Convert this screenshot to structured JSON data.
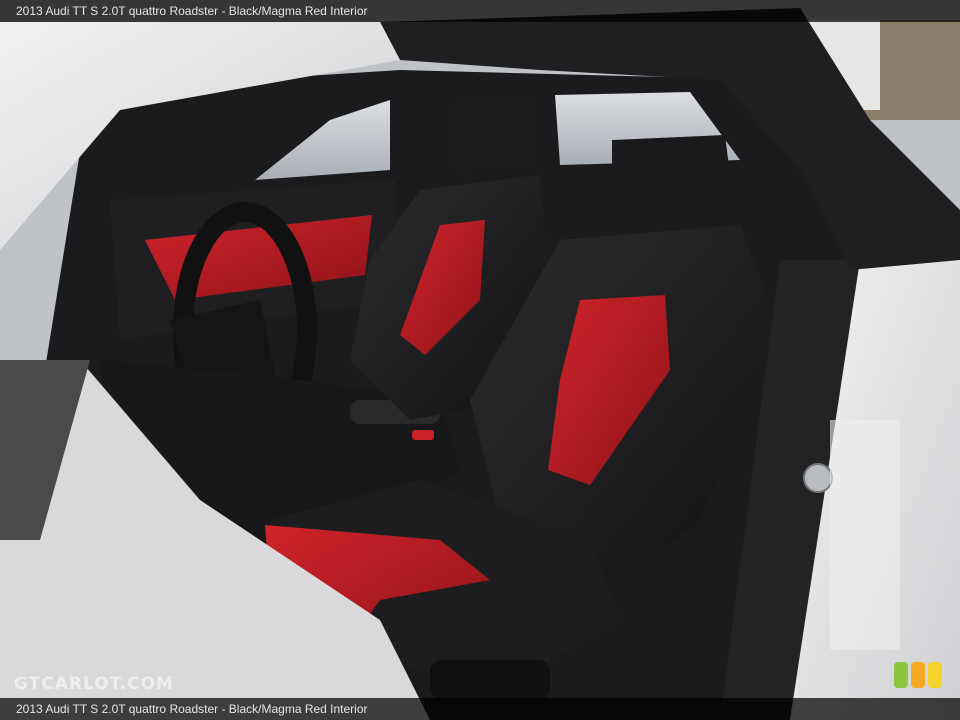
{
  "caption": {
    "top": "2013 Audi TT S 2.0T quattro Roadster - Black/Magma Red Interior",
    "bottom": "2013 Audi TT S 2.0T quattro Roadster - Black/Magma Red Interior"
  },
  "watermark": {
    "text": "GTCARLOT.COM"
  },
  "colors": {
    "seat_leather": "#1c1c1e",
    "seat_accent": "#b81e24",
    "body_paint": "#e8e8ea",
    "soft_top": "#1e1e20",
    "badge_green": "#8cc63f",
    "badge_orange": "#f7a823",
    "badge_yellow": "#f3d32c"
  },
  "icons": {
    "badge": "three-rounded-squares",
    "door_latch": "latch-icon"
  }
}
